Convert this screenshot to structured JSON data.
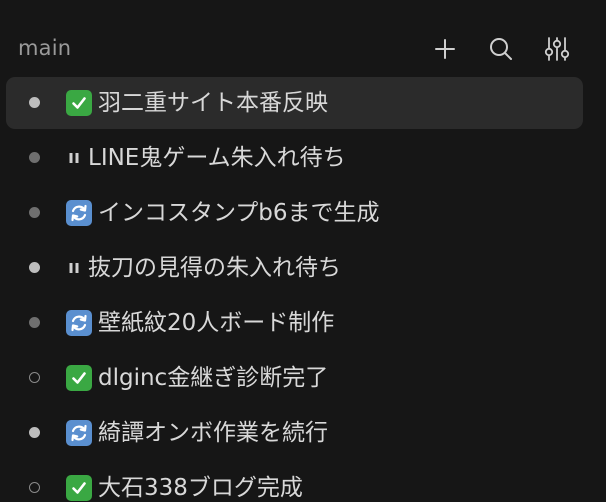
{
  "header": {
    "title": "main"
  },
  "tasks": [
    {
      "status": "done",
      "label": "羽二重サイト本番反映"
    },
    {
      "status": "paused",
      "label": "LINE鬼ゲーム朱入れ待ち"
    },
    {
      "status": "sync",
      "label": "インコスタンプb6まで生成"
    },
    {
      "status": "paused",
      "label": "抜刀の見得の朱入れ待ち"
    },
    {
      "status": "sync",
      "label": "壁紙紋20人ボード制作"
    },
    {
      "status": "done",
      "label": "dlginc金継ぎ診断完了"
    },
    {
      "status": "sync",
      "label": "綺譚オンボ作業を続行"
    },
    {
      "status": "done",
      "label": "大石338ブログ完成"
    }
  ],
  "icons": {
    "add": "plus-icon",
    "search": "search-icon",
    "filter": "sliders-icon",
    "done": "check-mark-button-icon",
    "sync": "anticlockwise-arrows-icon",
    "paused": "pause-icon"
  },
  "colors": {
    "background": "#161616",
    "selected_row": "#2b2b2b",
    "done_badge": "#3aa843",
    "sync_badge": "#5a8fcf",
    "text": "#d8d8d8",
    "muted": "#9a9a9a"
  }
}
